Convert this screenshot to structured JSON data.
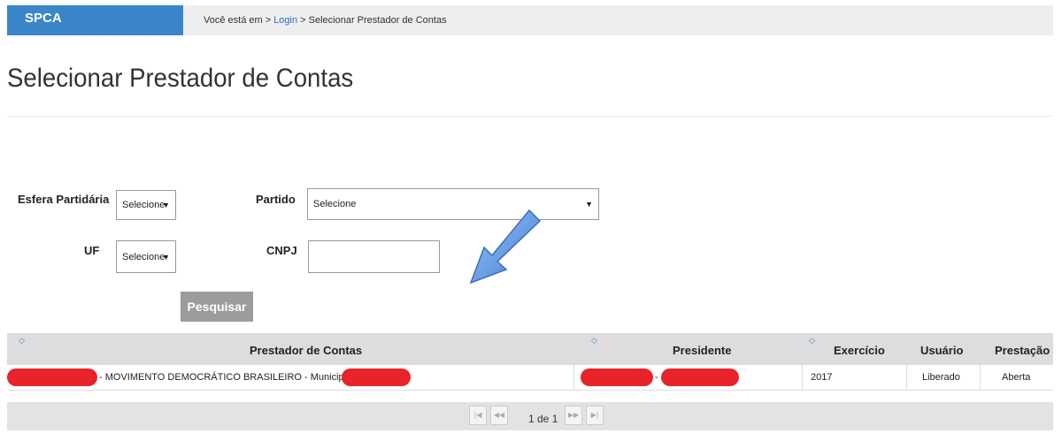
{
  "header": {
    "brand": "SPCA",
    "breadcrumb_prefix": "Você está em > ",
    "breadcrumb_link": "Login",
    "breadcrumb_current": " > Selecionar Prestador de Contas"
  },
  "page": {
    "title": "Selecionar Prestador de Contas"
  },
  "form": {
    "esfera_label": "Esfera Partidária",
    "esfera_value": "Selecione",
    "partido_label": "Partido",
    "partido_value": "Selecione",
    "uf_label": "UF",
    "uf_value": "Selecione",
    "cnpj_label": "CNPJ",
    "cnpj_value": "",
    "search_button": "Pesquisar"
  },
  "table": {
    "columns": [
      "Prestador de Contas",
      "Presidente",
      "Exercício",
      "Usuário",
      "Prestação"
    ],
    "rows": [
      {
        "prestador": "- MOVIMENTO DEMOCRÁTICO BRASILEIRO - Municipal - SC -",
        "presidente_sep": "-",
        "exercicio": "2017",
        "usuario": "Liberado",
        "prestacao": "Aberta"
      }
    ]
  },
  "pagination": {
    "text": "1 de 1"
  },
  "colors": {
    "brand": "#3a86c8",
    "redaction": "#e8232a",
    "header_bg": "#dddddd"
  },
  "icons": [
    "sort-icon",
    "dropdown-arrow-icon",
    "first-page-icon",
    "prev-page-icon",
    "next-page-icon",
    "last-page-icon",
    "arrow-annotation-icon"
  ]
}
